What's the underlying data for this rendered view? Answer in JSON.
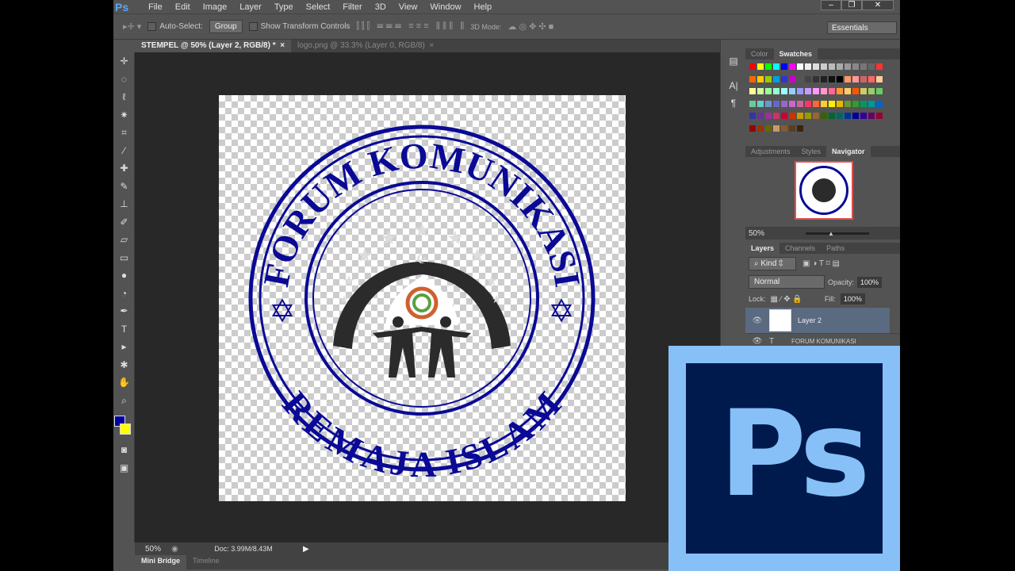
{
  "menubar": {
    "logo": "Ps",
    "items": [
      "File",
      "Edit",
      "Image",
      "Layer",
      "Type",
      "Select",
      "Filter",
      "3D",
      "View",
      "Window",
      "Help"
    ],
    "window_buttons": [
      "–",
      "❐",
      "✕"
    ]
  },
  "options": {
    "auto_select_label": "Auto-Select:",
    "auto_select_value": "Group",
    "show_transform_label": "Show Transform Controls",
    "mode_3d_label": "3D Mode:",
    "workspace": "Essentials"
  },
  "tabs": [
    {
      "label": "STEMPEL @ 50% (Layer 2, RGB/8) *",
      "close": "×"
    },
    {
      "label": "logo.png @ 33.3% (Layer 0, RGB/8)",
      "close": "×"
    }
  ],
  "stamp": {
    "top_text": "FORUM KOMUNIKASI",
    "bottom_text": "REMAJA ISLAM",
    "color": "#0a0a96"
  },
  "status": {
    "zoom": "50%",
    "doc": "Doc: 3.99M/8.43M"
  },
  "bottom_tabs": [
    "Mini Bridge",
    "Timeline"
  ],
  "color_panel": {
    "tabs": [
      "Color",
      "Swatches"
    ],
    "active": "Swatches"
  },
  "swatches": [
    "#ff0000",
    "#ffff00",
    "#00ff00",
    "#00ffff",
    "#0000ff",
    "#ff00ff",
    "#ffffff",
    "#eeeeee",
    "#dddddd",
    "#cccccc",
    "#bbbbbb",
    "#aaaaaa",
    "#999999",
    "#888888",
    "#777777",
    "#666666",
    "#ff3333",
    "#ff6600",
    "#ffcc00",
    "#99cc00",
    "#00a0e0",
    "#3333cc",
    "#cc00cc",
    "#555555",
    "#444444",
    "#333333",
    "#222222",
    "#111111",
    "#000000",
    "#ff9966",
    "#ff9999",
    "#cc6666",
    "#ff6666",
    "#ffcc99",
    "#ffff99",
    "#ccff99",
    "#99ff99",
    "#99ffcc",
    "#99ffff",
    "#99ccff",
    "#9999ff",
    "#cc99ff",
    "#ff99ff",
    "#ff99cc",
    "#ff6699",
    "#ff9933",
    "#ffcc66",
    "#ff5500",
    "#cccc66",
    "#99cc66",
    "#66cc66",
    "#66cc99",
    "#66cccc",
    "#6699cc",
    "#6666cc",
    "#9966cc",
    "#cc66cc",
    "#cc6699",
    "#ff3366",
    "#ff6633",
    "#ffcc33",
    "#ffee00",
    "#e6b800",
    "#669933",
    "#339933",
    "#009966",
    "#009999",
    "#0066cc",
    "#3333aa",
    "#663399",
    "#993399",
    "#cc3366",
    "#cc0033",
    "#cc3300",
    "#cc9900",
    "#999900",
    "#996633",
    "#336600",
    "#006633",
    "#006666",
    "#003399",
    "#000099",
    "#330099",
    "#660066",
    "#990033",
    "#990000",
    "#993300",
    "#666600",
    "#cc9966",
    "#8b5a2b",
    "#5c3d1e",
    "#3b2511"
  ],
  "navigator": {
    "tabs": [
      "Adjustments",
      "Styles",
      "Navigator"
    ],
    "active": "Navigator",
    "zoom": "50%"
  },
  "layers": {
    "tabs": [
      "Layers",
      "Channels",
      "Paths"
    ],
    "active": "Layers",
    "filter": "Kind",
    "blend_mode": "Normal",
    "opacity_label": "Opacity:",
    "opacity": "100%",
    "lock_label": "Lock:",
    "fill_label": "Fill:",
    "fill": "100%",
    "items": [
      {
        "name": "Layer 2",
        "selected": true
      },
      {
        "name": "FORUM KOMUNIKASI",
        "selected": false
      }
    ]
  },
  "foreground_color": "#0000a0",
  "background_color": "#ffff00",
  "overlay_logo": "Ps"
}
